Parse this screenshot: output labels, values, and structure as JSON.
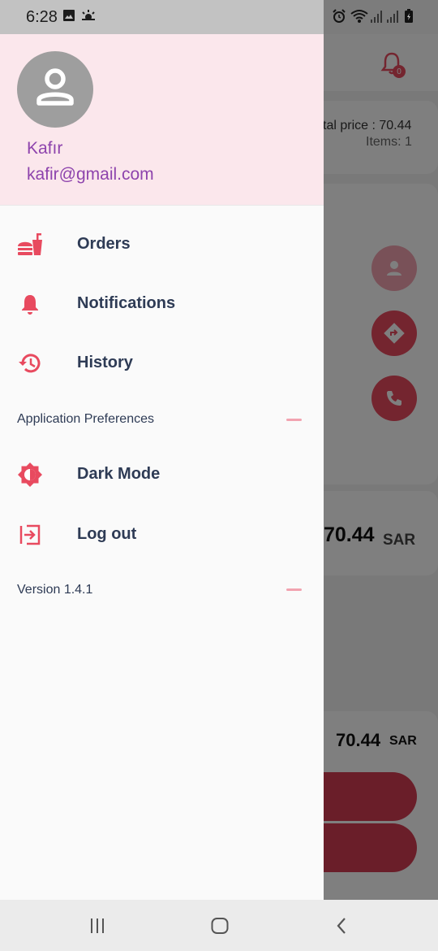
{
  "status_bar": {
    "time": "6:28",
    "left_icons": [
      "image-icon",
      "weather-icon"
    ],
    "right_icons": [
      "alarm-icon",
      "wifi-icon",
      "signal-icon",
      "signal-icon",
      "battery-charging-icon"
    ]
  },
  "drawer": {
    "user": {
      "avatar_icon": "person-icon",
      "name": "Kafır",
      "email": "kafir@gmail.com"
    },
    "menu": [
      {
        "label": "Orders",
        "icon": "fast-food-icon"
      },
      {
        "label": "Notifications",
        "icon": "bell-icon"
      },
      {
        "label": "History",
        "icon": "history-icon"
      }
    ],
    "preferences_label": "Application Preferences",
    "preferences": [
      {
        "label": "Dark Mode",
        "icon": "brightness-icon"
      },
      {
        "label": "Log out",
        "icon": "logout-icon"
      }
    ],
    "version_label": "Version 1.4.1"
  },
  "background": {
    "notification_count": "0",
    "total_price": "tal price : 70.44",
    "items": "Items: 1",
    "amount": "70.44",
    "currency": "SAR",
    "bottom_amount": "70.44",
    "bottom_currency": "SAR"
  },
  "colors": {
    "accent": "#e84a5f",
    "drawer_header": "#fbe7ec",
    "user_text": "#8e44ad",
    "menu_text": "#2e3b55"
  },
  "nav_bar": {
    "buttons": [
      "recents-icon",
      "home-icon",
      "back-icon"
    ]
  }
}
